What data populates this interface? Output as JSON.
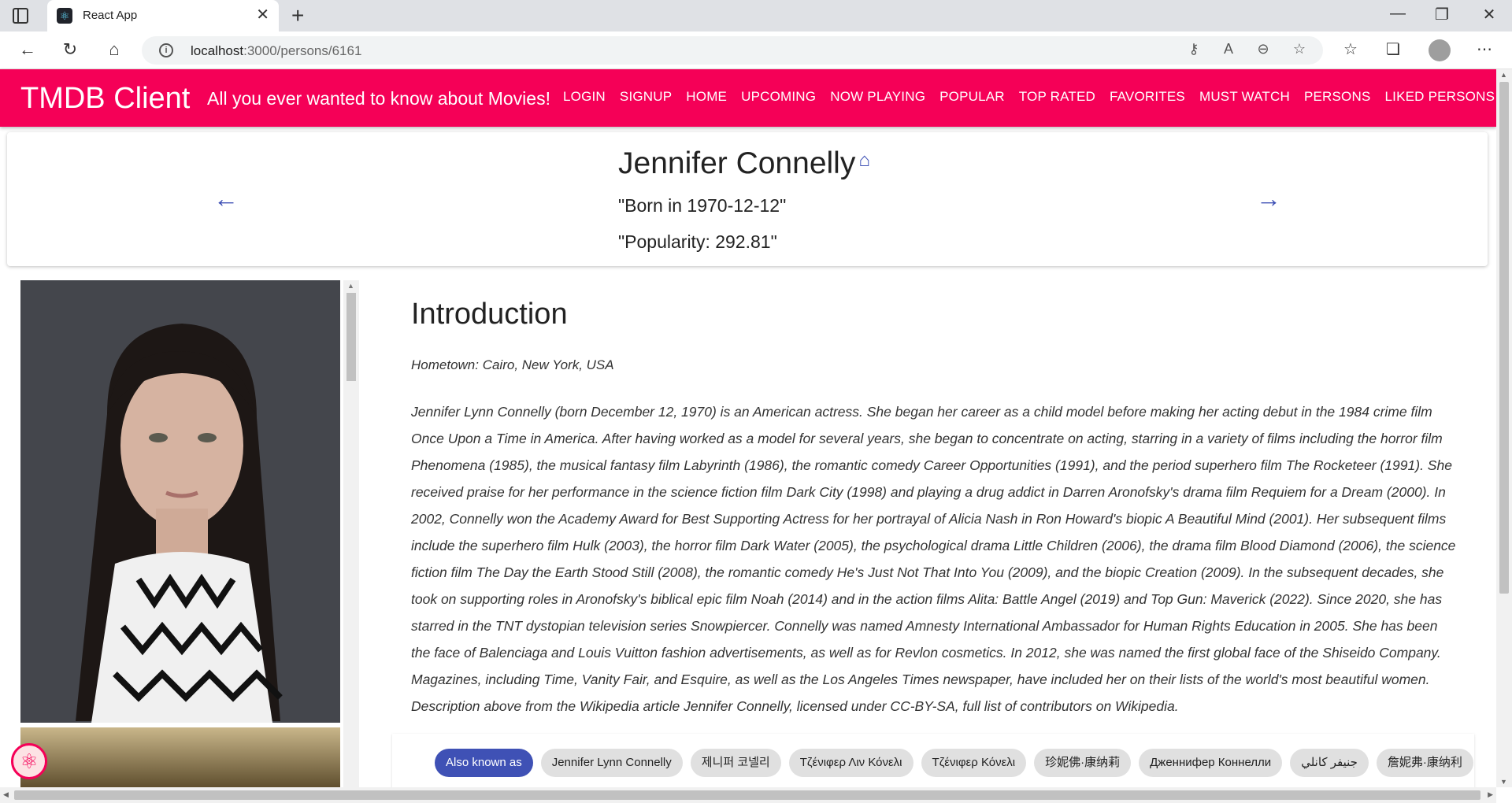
{
  "browser": {
    "tab_title": "React App",
    "url_host": "localhost",
    "url_rest": ":3000/persons/6161"
  },
  "appbar": {
    "title": "TMDB Client",
    "tagline": "All you ever wanted to know about Movies!",
    "nav": [
      "Login",
      "Signup",
      "Home",
      "Upcoming",
      "Now Playing",
      "Popular",
      "Top Rated",
      "Favorites",
      "Must Watch",
      "Persons",
      "Liked Persons"
    ]
  },
  "person": {
    "name": "Jennifer Connelly",
    "born": "\"Born in 1970-12-12\"",
    "popularity": "\"Popularity: 292.81\""
  },
  "intro": {
    "title": "Introduction",
    "hometown": "Hometown: Cairo, New York, USA",
    "bio": "Jennifer Lynn Connelly (born December 12, 1970) is an American actress. She began her career as a child model before making her acting debut in the 1984 crime film Once Upon a Time in America. After having worked as a model for several years, she began to concentrate on acting, starring in a variety of films including the horror film Phenomena (1985), the musical fantasy film Labyrinth (1986), the romantic comedy Career Opportunities (1991), and the period superhero film The Rocketeer (1991). She received praise for her performance in the science fiction film Dark City (1998) and playing a drug addict in Darren Aronofsky's drama film Requiem for a Dream (2000). In 2002, Connelly won the Academy Award for Best Supporting Actress for her portrayal of Alicia Nash in Ron Howard's biopic A Beautiful Mind (2001). Her subsequent films include the superhero film Hulk (2003), the horror film Dark Water (2005), the psychological drama Little Children (2006), the drama film Blood Diamond (2006), the science fiction film The Day the Earth Stood Still (2008), the romantic comedy He's Just Not That Into You (2009), and the biopic Creation (2009). In the subsequent decades, she took on supporting roles in Aronofsky's biblical epic film Noah (2014) and in the action films Alita: Battle Angel (2019) and Top Gun: Maverick (2022). Since 2020, she has starred in the TNT dystopian television series Snowpiercer. Connelly was named Amnesty International Ambassador for Human Rights Education in 2005. She has been the face of Balenciaga and Louis Vuitton fashion advertisements, as well as for Revlon cosmetics. In 2012, she was named the first global face of the Shiseido Company. Magazines, including Time, Vanity Fair, and Esquire, as well as the Los Angeles Times newspaper, have included her on their lists of the world's most beautiful women. Description above from the Wikipedia article Jennifer Connelly, licensed under CC-BY-SA, full list of contributors on Wikipedia."
  },
  "aka": {
    "label": "Also known as",
    "names": [
      "Jennifer Lynn Connelly",
      "제니퍼 코넬리",
      "Τζένιφερ Λιν Κόνελι",
      "Τζένιφερ Κόνελι",
      "珍妮佛·康纳莉",
      "Дженнифер Коннелли",
      "جنيفر كانلي",
      "詹妮弗·康纳利"
    ]
  },
  "colors": {
    "appbar": "#f50057",
    "primary": "#3f51b5"
  }
}
